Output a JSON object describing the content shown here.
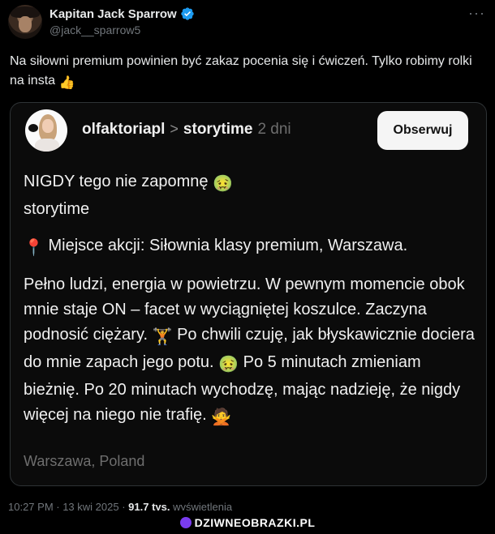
{
  "tweet": {
    "display_name": "Kapitan Jack Sparrow",
    "handle": "@jack__sparrow5",
    "more": "···",
    "text": "Na siłowni premium powinien być zakaz pocenia się i ćwiczeń. Tylko robimy rolki na insta",
    "text_emoji": "👍"
  },
  "quote": {
    "username": "olfaktoriapl",
    "chevron": ">",
    "topic": "storytime",
    "time": "2 dni",
    "follow_label": "Obserwuj",
    "line1": "NIGDY tego nie zapomnę",
    "line1_emoji": "🤢",
    "line2": "storytime",
    "place_emoji": "📍",
    "place": "Miejsce akcji: Siłownia klasy premium, Warszawa.",
    "story_a": "Pełno ludzi, energia w powietrzu. W pewnym momencie obok mnie staje ON – facet w wyciągniętej koszulce. Zaczyna podnosić ciężary.",
    "story_a_emoji": "🏋",
    "story_b": "Po chwili czuję, jak błyskawicznie dociera do mnie zapach jego potu.",
    "story_b_emoji": "🤢",
    "story_c": "Po 5 minutach zmieniam bieżnię. Po 20 minutach wychodzę, mając nadzieję, że nigdy więcej na niego nie trafię.",
    "story_c_emoji": "🙅",
    "location": "Warszawa, Poland"
  },
  "meta": {
    "timestamp": "10:27 PM · 13 kwi 2025 ·",
    "views_count": "91,7 tys.",
    "views_label": "wyświetlenia"
  },
  "watermark": {
    "text": "DZIWNEOBRAZKI.PL"
  },
  "colors": {
    "verified": "#1d9bf0",
    "background": "#000000",
    "quote_border": "#2f3336"
  }
}
